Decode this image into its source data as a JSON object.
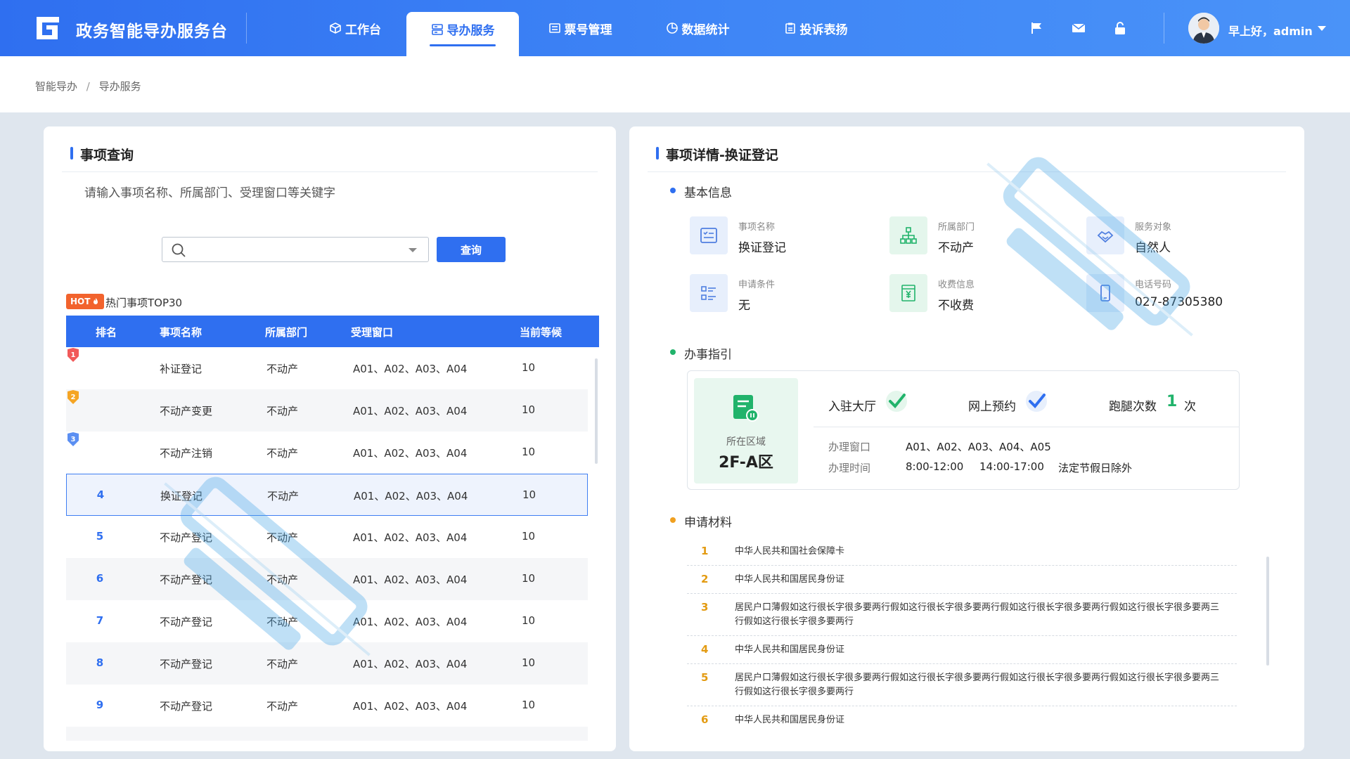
{
  "header": {
    "app_title": "政务智能导办服务台",
    "nav": [
      {
        "label": "工作台",
        "icon": "box-icon"
      },
      {
        "label": "导办服务",
        "icon": "server-icon",
        "active": true
      },
      {
        "label": "票号管理",
        "icon": "ticket-icon"
      },
      {
        "label": "数据统计",
        "icon": "pie-chart-icon"
      },
      {
        "label": "投诉表扬",
        "icon": "clipboard-icon"
      }
    ],
    "greeting": "早上好，admin",
    "icons": [
      "flag-icon",
      "mail-icon",
      "lock-icon"
    ]
  },
  "breadcrumb": {
    "root": "智能导办",
    "separator": "/",
    "current": "导办服务"
  },
  "search_panel": {
    "title": "事项查询",
    "hint": "请输入事项名称、所属部门、受理窗口等关键字",
    "search_value": "",
    "search_button": "查询",
    "hot_badge": "HOT",
    "hot_title": "热门事项TOP30",
    "columns": [
      "排名",
      "事项名称",
      "所属部门",
      "受理窗口",
      "当前等候"
    ],
    "rows": [
      {
        "rank": "1",
        "name": "补证登记",
        "dept": "不动产",
        "window": "A01、A02、A03、A04",
        "waiting": "10"
      },
      {
        "rank": "2",
        "name": "不动产变更",
        "dept": "不动产",
        "window": "A01、A02、A03、A04",
        "waiting": "10"
      },
      {
        "rank": "3",
        "name": "不动产注销",
        "dept": "不动产",
        "window": "A01、A02、A03、A04",
        "waiting": "10"
      },
      {
        "rank": "4",
        "name": "换证登记",
        "dept": "不动产",
        "window": "A01、A02、A03、A04",
        "waiting": "10"
      },
      {
        "rank": "5",
        "name": "不动产登记",
        "dept": "不动产",
        "window": "A01、A02、A03、A04",
        "waiting": "10"
      },
      {
        "rank": "6",
        "name": "不动产登记",
        "dept": "不动产",
        "window": "A01、A02、A03、A04",
        "waiting": "10"
      },
      {
        "rank": "7",
        "name": "不动产登记",
        "dept": "不动产",
        "window": "A01、A02、A03、A04",
        "waiting": "10"
      },
      {
        "rank": "8",
        "name": "不动产登记",
        "dept": "不动产",
        "window": "A01、A02、A03、A04",
        "waiting": "10"
      },
      {
        "rank": "9",
        "name": "不动产登记",
        "dept": "不动产",
        "window": "A01、A02、A03、A04",
        "waiting": "10"
      }
    ]
  },
  "detail_panel": {
    "title": "事项详情-换证登记",
    "basic": {
      "section": "基本信息",
      "item_name_label": "事项名称",
      "item_name": "换证登记",
      "dept_label": "所属部门",
      "dept": "不动产",
      "target_label": "服务对象",
      "target": "自然人",
      "condition_label": "申请条件",
      "condition": "无",
      "fee_label": "收费信息",
      "fee": "不收费",
      "phone_label": "电话号码",
      "phone": "027-87305380"
    },
    "guide": {
      "section": "办事指引",
      "area_label": "所在区域",
      "area": "2F-A区",
      "hall": "入驻大厅",
      "online": "网上预约",
      "runs_label": "跑腿次数",
      "runs": "1",
      "runs_unit": "次",
      "window_label": "办理窗口",
      "windows": "A01、A02、A03、A04、A05",
      "time_label": "办理时间",
      "time_am": "8:00-12:00",
      "time_pm": "14:00-17:00",
      "time_note": "法定节假日除外"
    },
    "materials": {
      "section": "申请材料",
      "items": [
        {
          "num": "1",
          "text": "中华人民共和国社会保障卡"
        },
        {
          "num": "2",
          "text": "中华人民共和国居民身份证"
        },
        {
          "num": "3",
          "text": "居民户口薄假如这行很长字很多要两行假如这行很长字很多要两行假如这行很长字很多要两行假如这行很长字很多要两三行假如这行很长字很多要两行"
        },
        {
          "num": "4",
          "text": "中华人民共和国居民身份证"
        },
        {
          "num": "5",
          "text": "居民户口薄假如这行很长字很多要两行假如这行很长字很多要两行假如这行很长字很多要两行假如这行很长字很多要两三行假如这行很长字很多要两行"
        },
        {
          "num": "6",
          "text": "中华人民共和国居民身份证"
        }
      ]
    }
  },
  "colors": {
    "primary": "#2f6ff0",
    "green": "#21b36b",
    "orange": "#e39b12",
    "hot": "#f2632d"
  }
}
